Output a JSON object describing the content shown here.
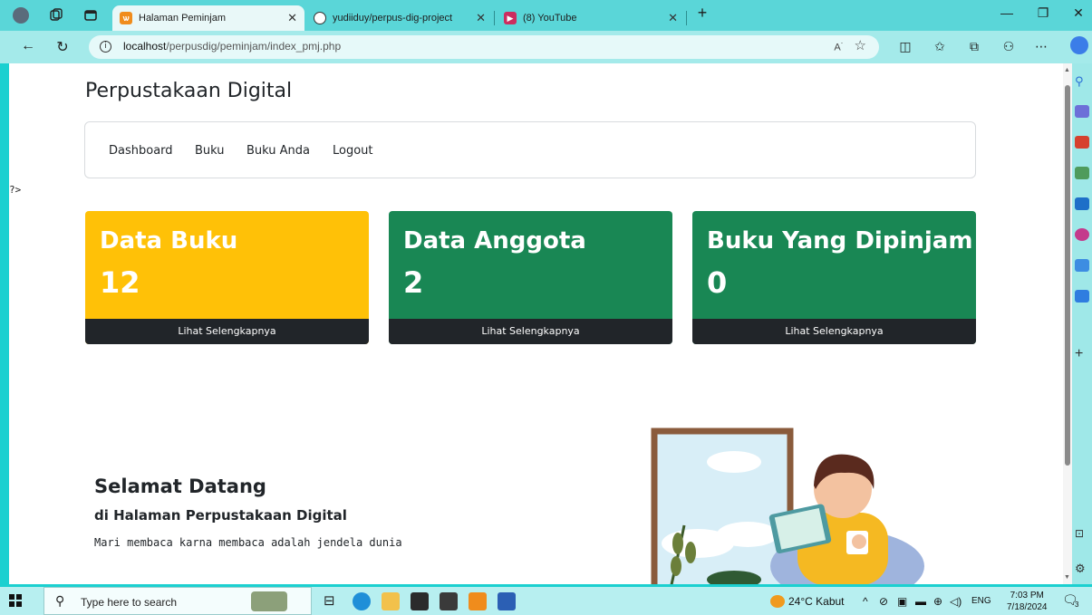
{
  "browser": {
    "tabs": [
      {
        "title": "Halaman Peminjam",
        "active": true
      },
      {
        "title": "yudiiduy/perpus-dig-project",
        "active": false
      },
      {
        "title": "(8) YouTube",
        "active": false
      }
    ],
    "url_host": "localhost",
    "url_path": "/perpusdig/peminjam/index_pmj.php"
  },
  "site": {
    "brand": "Perpustakaan Digital",
    "nav": [
      "Dashboard",
      "Buku",
      "Buku Anda",
      "Logout"
    ],
    "stray_text": "?>"
  },
  "cards": [
    {
      "title": "Data Buku",
      "value": "12",
      "footer": "Lihat Selengkapnya",
      "color": "#ffc107"
    },
    {
      "title": "Data Anggota",
      "value": "2",
      "footer": "Lihat Selengkapnya",
      "color": "#198754"
    },
    {
      "title": "Buku Yang Dipinjam",
      "value": "0",
      "footer": "Lihat Selengkapnya",
      "color": "#198754"
    }
  ],
  "welcome": {
    "title": "Selamat Datang",
    "subtitle": "di Halaman Perpustakaan Digital",
    "text": "Mari membaca karna membaca adalah jendela dunia"
  },
  "taskbar": {
    "search_placeholder": "Type here to search",
    "weather": "24°C  Kabut",
    "lang": "ENG",
    "time": "7:03 PM",
    "date": "7/18/2024",
    "notif_count": "3"
  }
}
